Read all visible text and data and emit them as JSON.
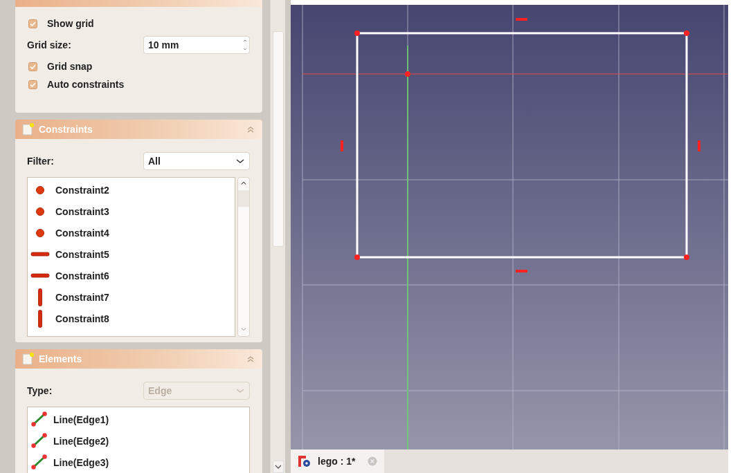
{
  "settings_panel": {
    "rows": [
      {
        "kind": "checkbox",
        "label": "Show grid",
        "checked": true
      },
      {
        "kind": "spinbox",
        "label": "Grid size:",
        "value": "10 mm"
      },
      {
        "kind": "checkbox",
        "label": "Grid snap",
        "checked": true
      },
      {
        "kind": "checkbox",
        "label": "Auto constraints",
        "checked": true
      }
    ]
  },
  "constraints_panel": {
    "title": "Constraints",
    "filter": {
      "label": "Filter:",
      "value": "All",
      "disabled": false
    },
    "items": [
      {
        "kind": "point",
        "label": "Constraint2"
      },
      {
        "kind": "point",
        "label": "Constraint3"
      },
      {
        "kind": "point",
        "label": "Constraint4"
      },
      {
        "kind": "horizontal",
        "label": "Constraint5"
      },
      {
        "kind": "horizontal",
        "label": "Constraint6"
      },
      {
        "kind": "vertical",
        "label": "Constraint7"
      },
      {
        "kind": "vertical",
        "label": "Constraint8"
      }
    ]
  },
  "elements_panel": {
    "title": "Elements",
    "type": {
      "label": "Type:",
      "value": "Edge",
      "disabled": true
    },
    "items": [
      {
        "kind": "line",
        "label": "Line(Edge1)"
      },
      {
        "kind": "line",
        "label": "Line(Edge2)"
      },
      {
        "kind": "line",
        "label": "Line(Edge3)"
      }
    ]
  },
  "document_tab": {
    "label": "lego : 1*",
    "selected": true
  }
}
